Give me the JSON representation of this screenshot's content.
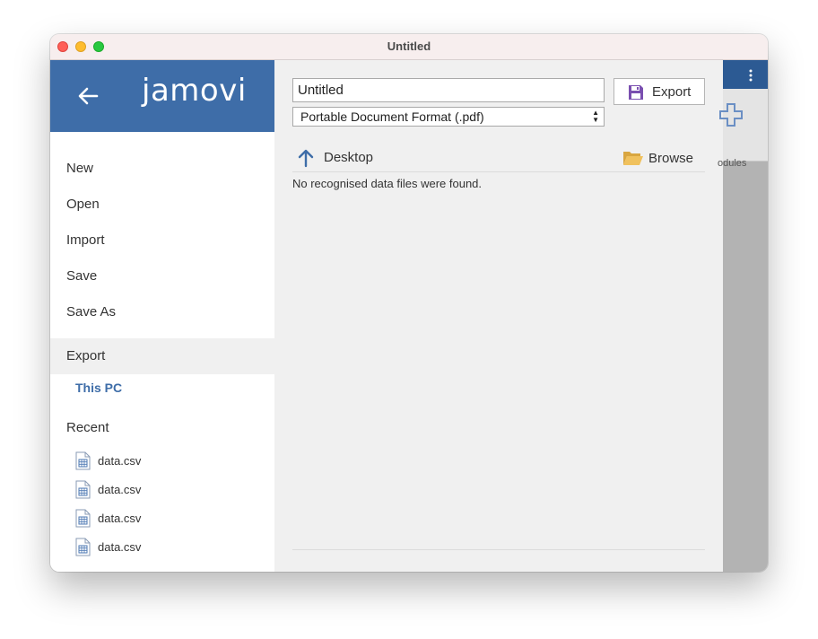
{
  "window": {
    "title": "Untitled"
  },
  "sidebar": {
    "logo": "jamovi",
    "items": [
      {
        "label": "New"
      },
      {
        "label": "Open"
      },
      {
        "label": "Import"
      },
      {
        "label": "Save"
      },
      {
        "label": "Save As"
      },
      {
        "label": "Export"
      }
    ],
    "sub_item": "This PC",
    "recent_label": "Recent",
    "recent": [
      {
        "name": "data.csv"
      },
      {
        "name": "data.csv"
      },
      {
        "name": "data.csv"
      },
      {
        "name": "data.csv"
      }
    ]
  },
  "export": {
    "filename": "Untitled",
    "button_label": "Export",
    "format": "Portable Document Format (.pdf)",
    "path": "Desktop",
    "browse_label": "Browse",
    "empty_message": "No recognised data files were found."
  },
  "background_app": {
    "toolbar_label": "odules"
  },
  "colors": {
    "brand": "#3e6da8",
    "panel": "#f0f0f0",
    "accent_save": "#7a4fb0"
  }
}
